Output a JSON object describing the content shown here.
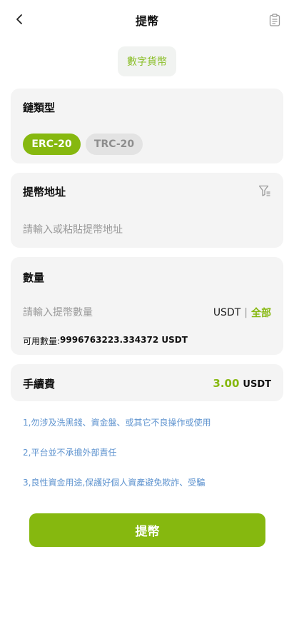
{
  "header": {
    "title": "提幣"
  },
  "currency_tab": {
    "label": "數字貨幣"
  },
  "chain": {
    "title": "鏈類型",
    "options": [
      {
        "label": "ERC-20",
        "selected": true
      },
      {
        "label": "TRC-20",
        "selected": false
      }
    ]
  },
  "address": {
    "title": "提幣地址",
    "placeholder": "請輸入或粘貼提幣地址"
  },
  "amount": {
    "title": "數量",
    "placeholder": "請輸入提幣數量",
    "unit": "USDT",
    "separator": "|",
    "all_label": "全部",
    "available_label": "可用數量:",
    "available_value": "9996763223.334372 USDT"
  },
  "fee": {
    "title": "手續費",
    "value": "3.00",
    "unit": "USDT"
  },
  "notes": [
    "1,勿涉及洗黑錢、資金盤、或其它不良操作或使用",
    "2,平台並不承擔外部責任",
    "3,良性資金用途,保護好個人資產避免欺詐、受騙"
  ],
  "submit": {
    "label": "提幣"
  },
  "colors": {
    "accent": "#86b80f",
    "note": "#5e93cf",
    "card_bg": "#f4f4f4"
  },
  "icons": {
    "back": "chevron-left-icon",
    "record": "clipboard-icon",
    "filter": "filter-icon"
  }
}
